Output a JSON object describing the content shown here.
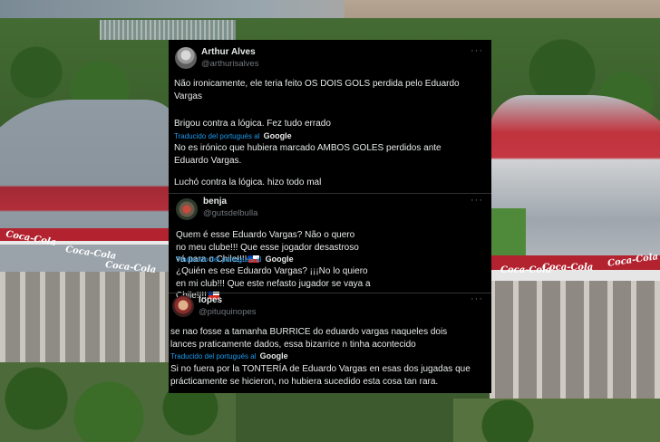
{
  "background": {
    "ads": [
      "Coca-Cola",
      "Coca-Cola",
      "Coca-Cola",
      "Coca-Cola",
      "Coca-Cola",
      "Coca-Cola"
    ]
  },
  "tweets": [
    {
      "name": "Arthur Alves",
      "handle": "@arthurisalves",
      "more": "···",
      "original": [
        "Não ironicamente, ele teria feito OS DOIS GOLS perdida pelo Eduardo Vargas",
        "Brigou contra a lógica. Fez tudo errado"
      ],
      "translated_label": "Traducido del portugués al",
      "google": "Google",
      "translation": [
        "No es irónico que hubiera marcado AMBOS GOLES perdidos ante Eduardo Vargas.",
        "Luchó contra la lógica. hizo todo mal"
      ]
    },
    {
      "name": "benja",
      "handle": "@gutsdelbulla",
      "more": "···",
      "original": "Quem é esse Eduardo Vargas? Não o quero no meu clube!!! Que esse jogador desastroso vá para o Chile!!!!",
      "translated_label": "Traducido del portugués al",
      "google": "Google",
      "translation": "¿Quién es ese Eduardo Vargas? ¡¡¡No lo quiero en mi club!!! Que este nefasto jugador se vaya a Chile!!!!"
    },
    {
      "name": "lopes",
      "handle": "@pituquinopes",
      "more": "···",
      "original": "se nao fosse a tamanha BURRICE do eduardo vargas naqueles dois lances praticamente dados, essa bizarrice n tinha acontecido",
      "translated_label": "Traducido del portugués al",
      "google": "Google",
      "translation": "Si no fuera por la TONTERÍA de Eduardo Vargas en esas dos jugadas que prácticamente se hicieron, no hubiera sucedido esta cosa tan rara."
    }
  ],
  "colors": {
    "card_bg": "#000000",
    "text": "#e7e9ea",
    "muted": "#71767b",
    "link": "#1d9bf0"
  }
}
